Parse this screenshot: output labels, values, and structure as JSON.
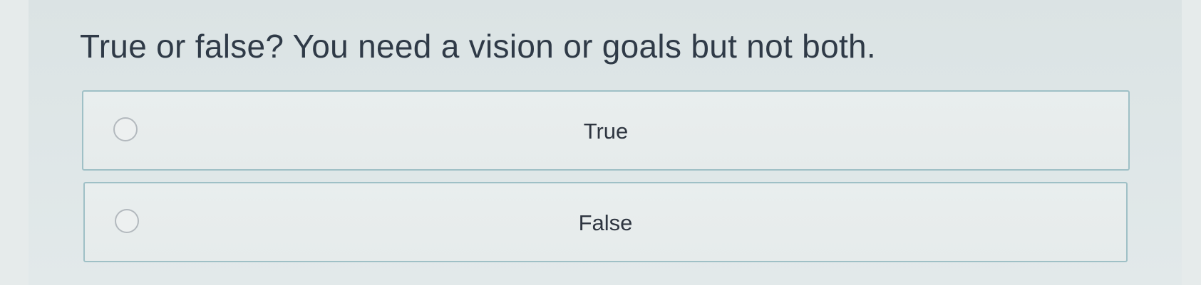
{
  "question": {
    "text": "True or false? You need a vision or goals but not both."
  },
  "options": [
    {
      "label": "True",
      "selected": false
    },
    {
      "label": "False",
      "selected": false
    }
  ],
  "colors": {
    "background": "#e6ebeb",
    "text": "#2f3a47",
    "option_border": "#9fc0c6",
    "radio_border": "#b3b9be"
  }
}
